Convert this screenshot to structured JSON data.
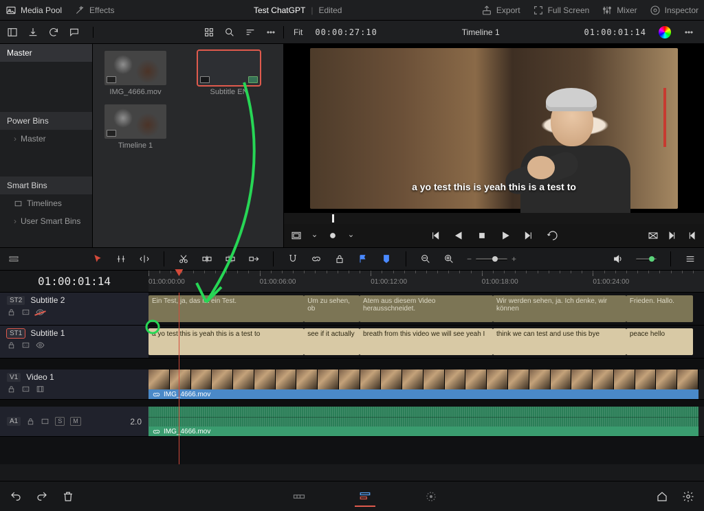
{
  "header": {
    "media_pool": "Media Pool",
    "effects": "Effects",
    "project": "Test ChatGPT",
    "status": "Edited",
    "export": "Export",
    "full_screen": "Full Screen",
    "mixer": "Mixer",
    "inspector": "Inspector"
  },
  "subheader": {
    "fit": "Fit",
    "source_tc": "00:00:27:10",
    "timeline_name": "Timeline 1",
    "timeline_tc": "01:00:01:14"
  },
  "sidebar": {
    "master": "Master",
    "power_bins": "Power Bins",
    "pb_master": "Master",
    "smart_bins": "Smart Bins",
    "timelines": "Timelines",
    "user_smart": "User Smart Bins"
  },
  "pool": {
    "clips": [
      {
        "label": "IMG_4666.mov"
      },
      {
        "label": "Timeline 1"
      },
      {
        "label": "Subtitle EN"
      }
    ]
  },
  "viewer": {
    "subtitle": "a yo test this is yeah this is a test to"
  },
  "ruler_tc": "01:00:01:14",
  "ruler_marks": [
    "01:00:00:00",
    "01:00:06:00",
    "01:00:12:00",
    "01:00:18:00",
    "01:00:24:00"
  ],
  "tracks": {
    "st2": {
      "tag": "ST2",
      "name": "Subtitle 2"
    },
    "st1": {
      "tag": "ST1",
      "name": "Subtitle 1"
    },
    "v1": {
      "tag": "V1",
      "name": "Video 1"
    },
    "a1": {
      "tag": "A1",
      "gain": "2.0"
    }
  },
  "subtitles_de": [
    {
      "start": 0,
      "end": 28,
      "text": "Ein Test, ja, das ist ein Test."
    },
    {
      "start": 28,
      "end": 38,
      "text": "Um zu sehen, ob"
    },
    {
      "start": 38,
      "end": 62,
      "text": "Atem aus diesem Video herausschneidet."
    },
    {
      "start": 62,
      "end": 86,
      "text": "Wir werden sehen, ja. Ich denke, wir können"
    },
    {
      "start": 86,
      "end": 98,
      "text": "Frieden. Hallo."
    }
  ],
  "subtitles_en": [
    {
      "start": 0,
      "end": 28,
      "text": "a yo test this is yeah this is a test to"
    },
    {
      "start": 28,
      "end": 38,
      "text": "see if it actually"
    },
    {
      "start": 38,
      "end": 62,
      "text": "breath from this video we will see yeah I"
    },
    {
      "start": 62,
      "end": 86,
      "text": "think we can test and use this bye"
    },
    {
      "start": 86,
      "end": 98,
      "text": "peace hello"
    }
  ],
  "video_clip": "IMG_4666.mov",
  "audio_clip": "IMG_4666.mov"
}
